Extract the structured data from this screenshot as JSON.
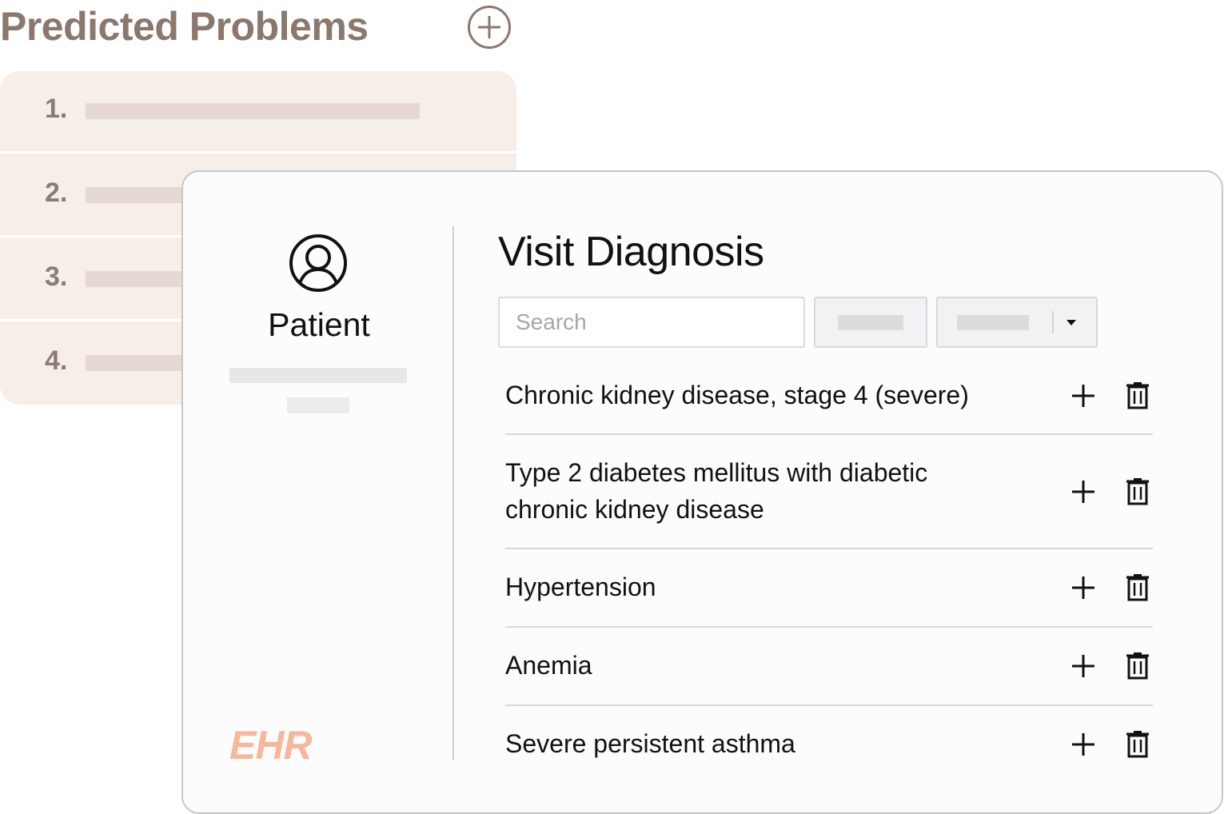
{
  "predicted_problems": {
    "title": "Predicted Problems",
    "add_icon": "plus-circle-icon",
    "items": [
      {
        "number": "1."
      },
      {
        "number": "2."
      },
      {
        "number": "3."
      },
      {
        "number": "4."
      }
    ]
  },
  "patient_panel": {
    "label": "Patient",
    "icon": "user-circle-icon",
    "logo": "EHR"
  },
  "visit_diagnosis": {
    "title": "Visit Diagnosis",
    "search_placeholder": "Search",
    "select_icon": "caret-down-icon",
    "diagnoses": [
      {
        "text": "Chronic kidney disease, stage 4 (severe)"
      },
      {
        "line1": "Type 2 diabetes mellitus with diabetic",
        "line2": "chronic kidney disease"
      },
      {
        "text": "Hypertension"
      },
      {
        "text": "Anemia"
      },
      {
        "text": "Severe persistent asthma"
      }
    ],
    "row_icons": {
      "add": "plus-icon",
      "delete": "trash-icon"
    }
  },
  "colors": {
    "problems_title": "#8a786d",
    "problems_bg": "#f6eee9",
    "ehr_logo": "#f6b79b",
    "text": "#111111"
  }
}
